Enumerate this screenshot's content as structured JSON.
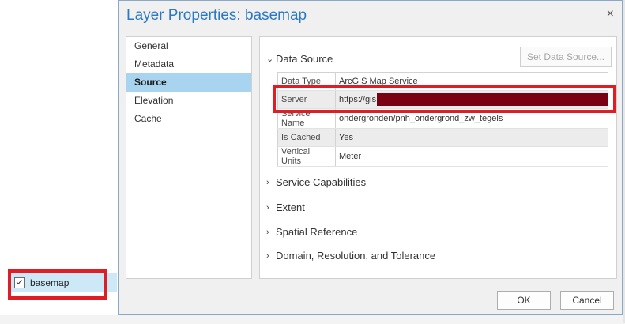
{
  "toc": {
    "layer_label": "basemap",
    "checkmark": "✓"
  },
  "dialog": {
    "title": "Layer Properties: basemap",
    "close_glyph": "×",
    "nav": [
      "General",
      "Metadata",
      "Source",
      "Elevation",
      "Cache"
    ],
    "active_nav": "Source",
    "data_source": {
      "header": "Data Source",
      "set_button": "Set Data Source...",
      "rows": [
        {
          "key": "Data Type",
          "value": "ArcGIS Map Service"
        },
        {
          "key": "Server",
          "value": "https://gis"
        },
        {
          "key": "Service Name",
          "value": "ondergronden/pnh_ondergrond_zw_tegels"
        },
        {
          "key": "Is Cached",
          "value": "Yes"
        },
        {
          "key": "Vertical Units",
          "value": "Meter"
        }
      ]
    },
    "collapsed_sections": [
      "Service Capabilities",
      "Extent",
      "Spatial Reference",
      "Domain, Resolution, and Tolerance"
    ],
    "ok_label": "OK",
    "cancel_label": "Cancel"
  },
  "colors": {
    "accent": "#2b79c2",
    "highlight": "#e01d24",
    "selection": "#a9d4ef",
    "redaction": "#7a0014"
  }
}
